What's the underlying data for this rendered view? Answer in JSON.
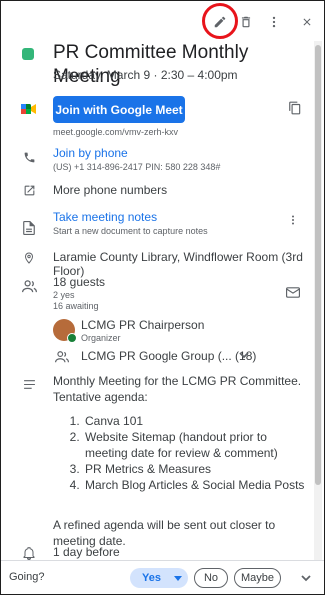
{
  "event": {
    "title": "PR Committee Monthly Meeting",
    "datetime": "Saturday, March 9 · 2:30 – 4:00pm",
    "color": "#33b679"
  },
  "meet": {
    "button_label": "Join with Google Meet",
    "url": "meet.google.com/vmv-zerh-kxv"
  },
  "phone": {
    "label": "Join by phone",
    "detail": "(US) +1 314-896-2417 PIN: 580 228 348#",
    "more": "More phone numbers"
  },
  "notes": {
    "label": "Take meeting notes",
    "detail": "Start a new document to capture notes"
  },
  "location": "Laramie County Library, Windflower Room (3rd Floor)",
  "guests": {
    "count": "18 guests",
    "yes": "2 yes",
    "awaiting": "16 awaiting",
    "organizer_name": "LCMG PR Chairperson",
    "organizer_role": "Organizer",
    "group": "LCMG PR Google Group (... (18)"
  },
  "description": {
    "intro": "Monthly Meeting for the LCMG PR Committee. Tentative agenda:",
    "items": [
      "Canva 101",
      "Website Sitemap (handout prior to meeting date for review & comment)",
      "PR Metrics & Measures",
      "March Blog Articles & Social Media Posts"
    ],
    "closing": "A refined agenda will be sent out closer to meeting date."
  },
  "reminder": "1 day before",
  "rsvp": {
    "prompt": "Going?",
    "yes": "Yes",
    "no": "No",
    "maybe": "Maybe"
  },
  "icons": {
    "edit": "pencil-icon",
    "delete": "trash-icon",
    "more": "more-vert-icon",
    "close": "close-icon"
  },
  "colors": {
    "accent": "#1a73e8",
    "highlight_ring": "#e8141b"
  }
}
